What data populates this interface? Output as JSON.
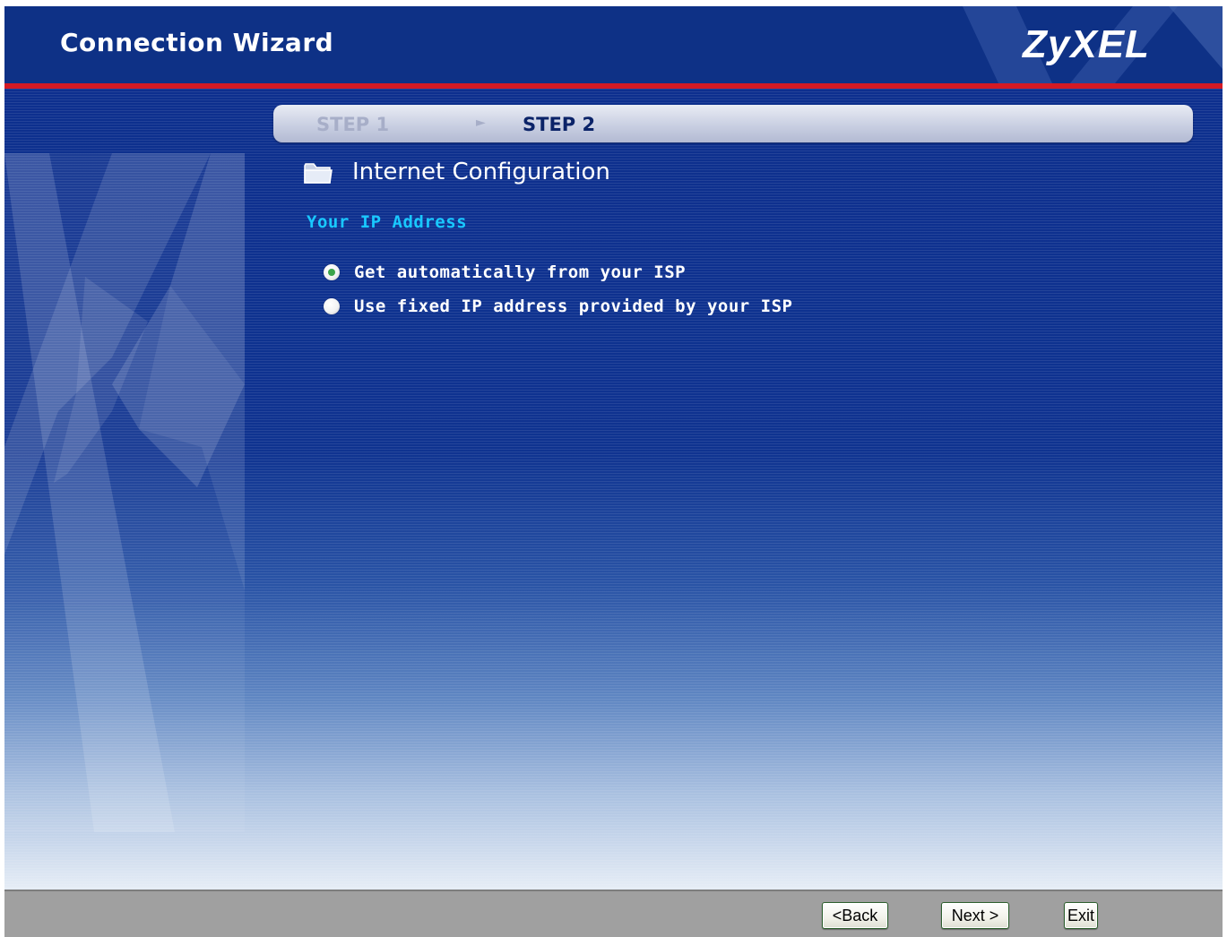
{
  "header": {
    "title": "Connection Wizard",
    "logo": "ZyXEL"
  },
  "steps": {
    "step1": "STEP 1",
    "step2": "STEP 2",
    "current": 2
  },
  "section": {
    "icon": "folder-icon",
    "title": "Internet Configuration"
  },
  "ip_address": {
    "label": "Your IP Address",
    "options": [
      {
        "label": "Get automatically from your ISP",
        "selected": true
      },
      {
        "label": "Use fixed IP address provided by your ISP",
        "selected": false
      }
    ]
  },
  "footer": {
    "back_label": "<Back",
    "next_label": "Next >",
    "exit_label": "Exit"
  },
  "colors": {
    "header_bg": "#0e3186",
    "accent_red": "#d41a24",
    "subtitle_cyan": "#19c8ff",
    "footer_bg": "#a0a0a0"
  }
}
